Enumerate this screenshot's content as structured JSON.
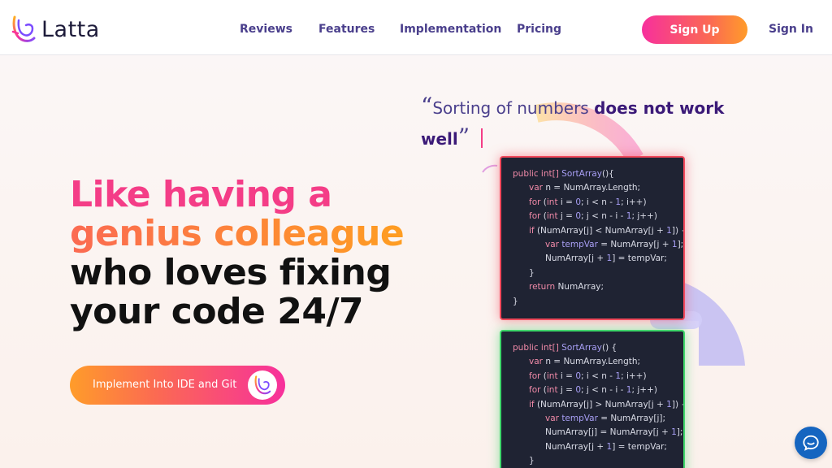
{
  "brand": {
    "name": "Latta"
  },
  "nav": [
    {
      "label": "Reviews"
    },
    {
      "label": "Features"
    },
    {
      "label": "Implementation"
    },
    {
      "label": "Pricing"
    }
  ],
  "auth": {
    "signup_label": "Sign Up",
    "signin_label": "Sign In"
  },
  "hero": {
    "line1": "Like having a",
    "line2": "genius colleague",
    "line3": "who loves fixing",
    "line4": "your code 24/7",
    "cta_label": "Implement Into IDE and Git"
  },
  "quote": {
    "open_mark": "“",
    "text_regular": "Sorting of numbers ",
    "text_bold_1": "does not work",
    "text_bold_2": "well",
    "close_mark": "”"
  },
  "code_bad": [
    [
      {
        "t": "public int[] ",
        "c": "kw"
      },
      {
        "t": "SortArray",
        "c": "fn"
      },
      {
        "t": "(){",
        "c": ""
      }
    ],
    [
      {
        "t": "var ",
        "c": "kw"
      },
      {
        "t": "n = NumArray.Length;",
        "c": ""
      }
    ],
    [
      {
        "t": "for ",
        "c": "kw"
      },
      {
        "t": "(",
        "c": ""
      },
      {
        "t": "int ",
        "c": "kw"
      },
      {
        "t": "i = ",
        "c": ""
      },
      {
        "t": "0",
        "c": "num"
      },
      {
        "t": "; i < n - ",
        "c": ""
      },
      {
        "t": "1",
        "c": "num"
      },
      {
        "t": "; i++)",
        "c": ""
      }
    ],
    [
      {
        "t": "for ",
        "c": "kw"
      },
      {
        "t": "(",
        "c": ""
      },
      {
        "t": "int ",
        "c": "kw"
      },
      {
        "t": "j = ",
        "c": ""
      },
      {
        "t": "0",
        "c": "num"
      },
      {
        "t": "; j < n - i - ",
        "c": ""
      },
      {
        "t": "1",
        "c": "num"
      },
      {
        "t": "; j++)",
        "c": ""
      }
    ],
    [
      {
        "t": "if ",
        "c": "kw"
      },
      {
        "t": "(NumArray[j] < NumArray[j + ",
        "c": ""
      },
      {
        "t": "1",
        "c": "num"
      },
      {
        "t": "]) {",
        "c": ""
      }
    ],
    [
      {
        "t": "var ",
        "c": "kw"
      },
      {
        "t": "tempVar",
        "c": "fn"
      },
      {
        "t": " = NumArray[j + ",
        "c": ""
      },
      {
        "t": "1",
        "c": "num"
      },
      {
        "t": "];",
        "c": ""
      }
    ],
    [
      {
        "t": "NumArray[j + ",
        "c": ""
      },
      {
        "t": "1",
        "c": "num"
      },
      {
        "t": "] = tempVar;",
        "c": ""
      }
    ],
    [
      {
        "t": "}",
        "c": ""
      }
    ],
    [
      {
        "t": "return ",
        "c": "kw"
      },
      {
        "t": "NumArray;",
        "c": ""
      }
    ],
    [
      {
        "t": "}",
        "c": ""
      }
    ]
  ],
  "code_bad_indent": [
    0,
    1,
    1,
    1,
    1,
    2,
    2,
    1,
    1,
    0
  ],
  "code_good": [
    [
      {
        "t": "public int[] ",
        "c": "kw"
      },
      {
        "t": "SortArray",
        "c": "fn"
      },
      {
        "t": "() {",
        "c": ""
      }
    ],
    [
      {
        "t": "var ",
        "c": "kw"
      },
      {
        "t": "n = NumArray.Length;",
        "c": ""
      }
    ],
    [
      {
        "t": "for ",
        "c": "kw"
      },
      {
        "t": "(",
        "c": ""
      },
      {
        "t": "int ",
        "c": "kw"
      },
      {
        "t": "i = ",
        "c": ""
      },
      {
        "t": "0",
        "c": "num"
      },
      {
        "t": "; i < n - ",
        "c": ""
      },
      {
        "t": "1",
        "c": "num"
      },
      {
        "t": "; i++)",
        "c": ""
      }
    ],
    [
      {
        "t": "for ",
        "c": "kw"
      },
      {
        "t": "(",
        "c": ""
      },
      {
        "t": "int ",
        "c": "kw"
      },
      {
        "t": "j = ",
        "c": ""
      },
      {
        "t": "0",
        "c": "num"
      },
      {
        "t": "; j < n - i - ",
        "c": ""
      },
      {
        "t": "1",
        "c": "num"
      },
      {
        "t": "; j++)",
        "c": ""
      }
    ],
    [
      {
        "t": "if ",
        "c": "kw"
      },
      {
        "t": "(NumArray[j] > NumArray[j + ",
        "c": ""
      },
      {
        "t": "1",
        "c": "num"
      },
      {
        "t": "]) {",
        "c": ""
      }
    ],
    [
      {
        "t": "var ",
        "c": "kw"
      },
      {
        "t": "tempVar",
        "c": "fn"
      },
      {
        "t": " = NumArray[j];",
        "c": ""
      }
    ],
    [
      {
        "t": "NumArray[j] = NumArray[j + ",
        "c": ""
      },
      {
        "t": "1",
        "c": "num"
      },
      {
        "t": "];",
        "c": ""
      }
    ],
    [
      {
        "t": "NumArray[j + ",
        "c": ""
      },
      {
        "t": "1",
        "c": "num"
      },
      {
        "t": "] = tempVar;",
        "c": ""
      }
    ],
    [
      {
        "t": "}",
        "c": ""
      }
    ]
  ],
  "code_good_indent": [
    0,
    1,
    1,
    1,
    1,
    2,
    2,
    2,
    1
  ],
  "colors": {
    "accent_pink": "#f7309c",
    "accent_orange": "#ff9c2a",
    "nav_text": "#4a3f8c",
    "code_bg": "#1f2333",
    "error_border": "#f2495c",
    "success_border": "#3fd66b",
    "chat_blue": "#1565c0"
  },
  "icons": {
    "logo": "latta-logo-icon",
    "cta": "latta-logo-icon",
    "chat": "chat-bubble-icon"
  }
}
